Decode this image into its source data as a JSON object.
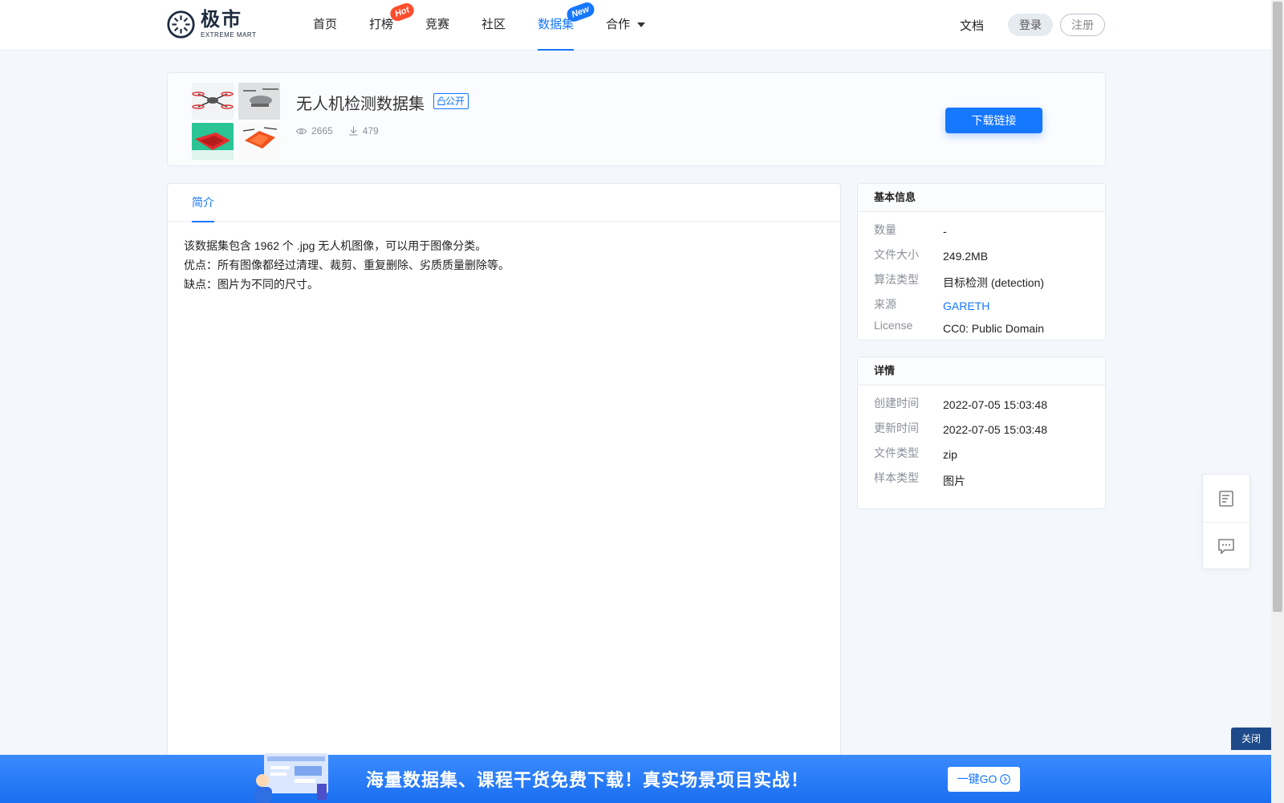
{
  "header": {
    "logo": {
      "cn": "极市",
      "en": "EXTREME MART"
    },
    "nav": [
      {
        "label": "首页",
        "badge": ""
      },
      {
        "label": "打榜",
        "badge": "Hot"
      },
      {
        "label": "竞赛",
        "badge": ""
      },
      {
        "label": "社区",
        "badge": ""
      },
      {
        "label": "数据集",
        "badge": "New",
        "active": true
      },
      {
        "label": "合作",
        "badge": "",
        "dropdown": true
      }
    ],
    "docs_label": "文档",
    "login_label": "登录",
    "register_label": "注册"
  },
  "dataset": {
    "title": "无人机检测数据集",
    "visibility": "公开",
    "views": "2665",
    "downloads": "479",
    "download_button": "下载链接",
    "thumbnails": [
      "drone-thumb-1",
      "drone-thumb-2",
      "drone-thumb-3",
      "drone-thumb-4"
    ]
  },
  "main": {
    "tab_label": "简介",
    "description": [
      "该数据集包含 1962 个 .jpg 无人机图像，可以用于图像分类。",
      "优点：所有图像都经过清理、裁剪、重复删除、劣质质量删除等。",
      "缺点：图片为不同的尺寸。"
    ]
  },
  "basic_info": {
    "title": "基本信息",
    "rows": [
      {
        "key": "数量",
        "value": "-"
      },
      {
        "key": "文件大小",
        "value": "249.2MB"
      },
      {
        "key": "算法类型",
        "value": "目标检测 (detection)"
      },
      {
        "key": "来源",
        "value": "GARETH"
      },
      {
        "key": "License",
        "value": "CC0: Public Domain"
      }
    ]
  },
  "details": {
    "title": "详情",
    "rows": [
      {
        "key": "创建时间",
        "value": "2022-07-05 15:03:48"
      },
      {
        "key": "更新时间",
        "value": "2022-07-05 15:03:48"
      },
      {
        "key": "文件类型",
        "value": "zip"
      },
      {
        "key": "样本类型",
        "value": "图片"
      }
    ]
  },
  "banner": {
    "text": "海量数据集、课程干货免费下载！真实场景项目实战！",
    "go_label": "一键GO",
    "close_label": "关闭"
  },
  "colors": {
    "accent": "#1677ff",
    "hot": "#ff4d2e",
    "banner": "#1a6ff0"
  }
}
